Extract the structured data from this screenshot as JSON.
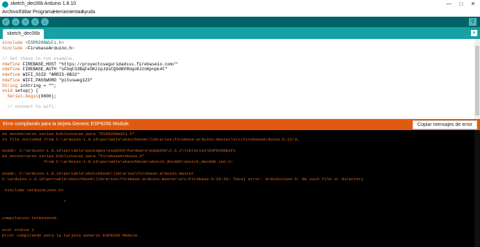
{
  "window": {
    "title": "sketch_dec06b Arduino 1.8.10",
    "minimize": "—",
    "maximize": "□",
    "close": "✕"
  },
  "menu": [
    "Archivo",
    "Editar",
    "Programa",
    "Herramientas",
    "Ayuda"
  ],
  "toolbar": {
    "verify": "✓",
    "upload": "→",
    "new": "▫",
    "open": "↑",
    "save": "↓",
    "serial_monitor": "⚲"
  },
  "tabs": [
    {
      "label": "sketch_dec06b"
    }
  ],
  "tab_menu_glyph": "▾",
  "editor_lines": [
    [
      {
        "t": "#include <",
        "c": "kw"
      },
      {
        "t": "ESP8266WiFi.h",
        "c": "st"
      },
      {
        "t": ">",
        "c": "kw"
      }
    ],
    [
      {
        "t": "#include <",
        "c": "kw"
      },
      {
        "t": "FirebaseArduino.h",
        "c": ""
      },
      {
        "t": ">",
        "c": "kw"
      }
    ],
    [],
    [
      {
        "t": "// Set these to run example.",
        "c": "cm"
      }
    ],
    [
      {
        "t": "#define ",
        "c": "kw"
      },
      {
        "t": "FIREBASE_HOST \"https://proyectoseguridadsss.firebaseio.com/\"",
        "c": ""
      }
    ],
    [
      {
        "t": "#define ",
        "c": "kw"
      },
      {
        "t": "FIREBASE_AUTH \"sFbqF33BqFeSKzzpJdsCQ9dNV8Uqo8JznKpnpk4C\"",
        "c": ""
      }
    ],
    [
      {
        "t": "#define ",
        "c": "kw"
      },
      {
        "t": "WIFI_SSID \"ARRIS-8B32\"",
        "c": ""
      }
    ],
    [
      {
        "t": "#define ",
        "c": "kw"
      },
      {
        "t": "WIFI_PASSWORD \"pitusweg123\"",
        "c": ""
      }
    ],
    [
      {
        "t": "String ",
        "c": "kw"
      },
      {
        "t": "inString = \"\";",
        "c": ""
      }
    ],
    [
      {
        "t": "void ",
        "c": "kw"
      },
      {
        "t": "setup() {",
        "c": ""
      }
    ],
    [
      {
        "t": "  ",
        "c": ""
      },
      {
        "t": "Serial",
        "c": "kw"
      },
      {
        "t": ".",
        "c": ""
      },
      {
        "t": "begin",
        "c": "kw"
      },
      {
        "t": "(9600);",
        "c": ""
      }
    ],
    [],
    [
      {
        "t": "  // connect to wifi.",
        "c": "cm"
      }
    ]
  ],
  "status_message": "Error compilando para la tarjeta Generic ESP8266 Module.",
  "copy_button": "Copiar mensajes de error",
  "console_lines": [
    "Se encontraron varias bibliotecas para \"ESP8266WiFi.h\"",
    "In file included from C:\\arduino-1.8.10\\portable\\sketchbook\\libraries\\firebase-arduino-master\\src/FirebaseArduino.h:22:0,",
    "",
    "Usado: C:\\arduino-1.8.10\\portable\\packages\\esp8266\\hardware\\esp8266\\2.6.2\\libraries\\ESP8266WiFi",
    "Se encontraron varias bibliotecas para \"FirebaseArduino.h\"",
    "                 from C:\\arduino-1.8.10\\portable\\sketchbook\\sketch_dec06b\\sketch_dec06b.ino:2:",
    "",
    "Usado: C:\\arduino-1.8.10\\portable\\sketchbook\\libraries\\firebase-arduino-master",
    "C:\\arduino-1.8.10\\portable\\sketchbook\\libraries\\firebase-arduino-master\\src/Firebase.h:26:25: fatal error: ArduinoJson.h: No such file or directory",
    "",
    " #include <ArduinoJson.h>",
    "",
    "                         ^",
    "",
    "",
    "compilation terminated.",
    "",
    "exit status 1",
    "Error compilando para la tarjeta Generic ESP8266 Module."
  ]
}
